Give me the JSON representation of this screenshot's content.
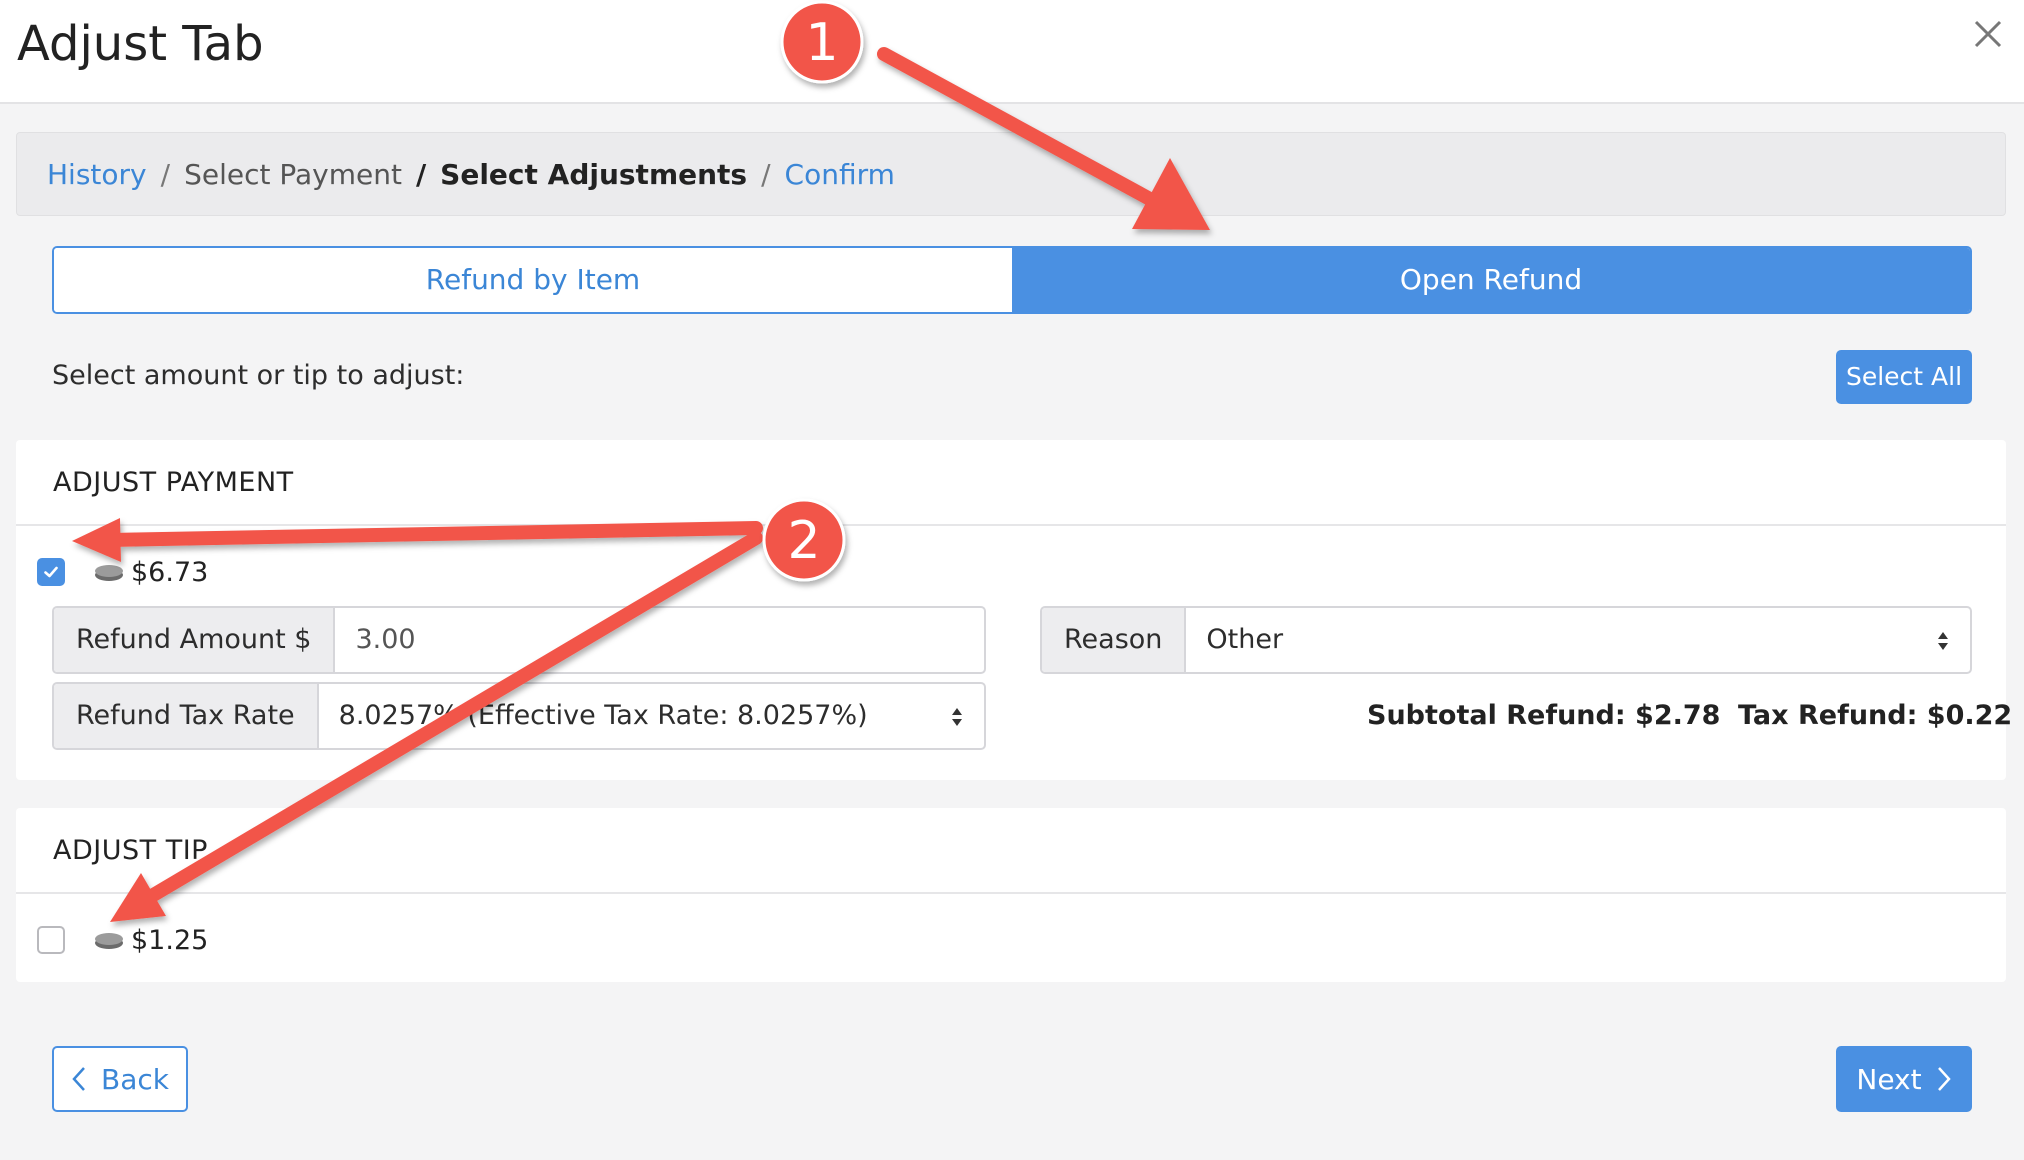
{
  "dialog": {
    "title": "Adjust Tab",
    "close_icon": "close-icon"
  },
  "breadcrumb": {
    "items": [
      {
        "label": "History",
        "state": "link"
      },
      {
        "label": "Select Payment",
        "state": "muted"
      },
      {
        "label": "Select Adjustments",
        "state": "active"
      },
      {
        "label": "Confirm",
        "state": "link"
      }
    ],
    "separator": "/"
  },
  "tabs": [
    {
      "label": "Refund by Item",
      "active": false
    },
    {
      "label": "Open Refund",
      "active": true
    }
  ],
  "instruction": "Select amount or tip to adjust:",
  "select_all_label": "Select All",
  "adjust_payment": {
    "heading": "ADJUST PAYMENT",
    "checked": true,
    "amount": "$6.73",
    "refund_amount_label": "Refund Amount $",
    "refund_amount_value": "3.00",
    "reason_label": "Reason",
    "reason_value": "Other",
    "tax_rate_label": "Refund Tax Rate",
    "tax_rate_value": "8.0257% (Effective Tax Rate: 8.0257%)",
    "subtotal_refund": "Subtotal Refund: $2.78",
    "tax_refund": "Tax Refund: $0.22"
  },
  "adjust_tip": {
    "heading": "ADJUST TIP",
    "checked": false,
    "amount": "$1.25"
  },
  "footer": {
    "back_label": "Back",
    "next_label": "Next"
  },
  "annotations": {
    "badge_1": "1",
    "badge_2": "2"
  },
  "colors": {
    "accent": "#4a90e2",
    "annotation_red": "#f2554a"
  }
}
